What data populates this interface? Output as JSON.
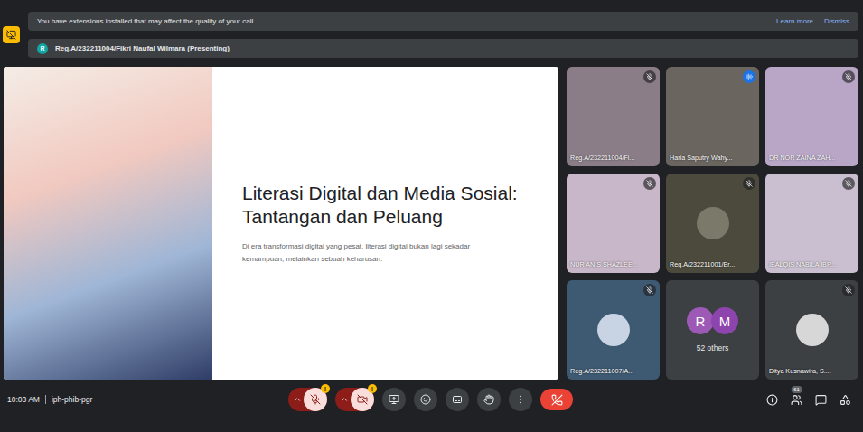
{
  "notification": {
    "text": "You have extensions installed that may affect the quality of your call",
    "actions": [
      "Learn more",
      "Dismiss"
    ]
  },
  "presenter": {
    "initial": "R",
    "label": "Reg.A/232211004/Fikri Naufal Wilmara (Presenting)"
  },
  "slide": {
    "title": "Literasi Digital dan Media Sosial: Tantangan dan Peluang",
    "body": "Di era transformasi digital yang pesat, literasi digital bukan lagi sekadar kemampuan, melainkan sebuah keharusan."
  },
  "tiles": [
    {
      "name": "Reg.A/232211004/Fi...",
      "kind": "video",
      "muted": true,
      "speaking": false,
      "color": "#8a7d88"
    },
    {
      "name": "Haria Saputry Wahy...",
      "kind": "video",
      "muted": false,
      "speaking": true,
      "color": "#6b6560"
    },
    {
      "name": "DR NOR ZAINA ZAH...",
      "kind": "video",
      "muted": true,
      "speaking": false,
      "color": "#b9a6c7"
    },
    {
      "name": "NUR ANIS SHAZLEE...",
      "kind": "video",
      "muted": true,
      "speaking": false,
      "color": "#c8b6c9"
    },
    {
      "name": "Reg.A/232211001/Er...",
      "kind": "avatar",
      "muted": true,
      "speaking": false,
      "color": "#4b4a3c",
      "avatar_color": "#7b7a6a"
    },
    {
      "name": "IBALQIS NABILA IBR...",
      "kind": "video",
      "muted": true,
      "speaking": false,
      "color": "#c9bfd0"
    },
    {
      "name": "Reg.A/232211007/A...",
      "kind": "avatar",
      "muted": true,
      "speaking": false,
      "color": "#3e5a72",
      "avatar_color": "#c8d4e3"
    },
    {
      "name": "52 others",
      "kind": "others",
      "muted": false,
      "speaking": false,
      "color": "#3c4043",
      "initials": [
        {
          "letter": "R",
          "color": "#9c59b6"
        },
        {
          "letter": "M",
          "color": "#8e44ad"
        }
      ]
    },
    {
      "name": "Ditya Kusnawira, S....",
      "kind": "avatar",
      "muted": true,
      "speaking": false,
      "color": "#3c4043",
      "avatar_color": "#d7d7d7"
    }
  ],
  "meeting": {
    "time": "10:03 AM",
    "code": "iph-phib-pgr"
  },
  "controls": {
    "mic_off": true,
    "camera_off": true,
    "mic_warning": "!",
    "camera_warning": "!"
  },
  "participants_count": "61"
}
